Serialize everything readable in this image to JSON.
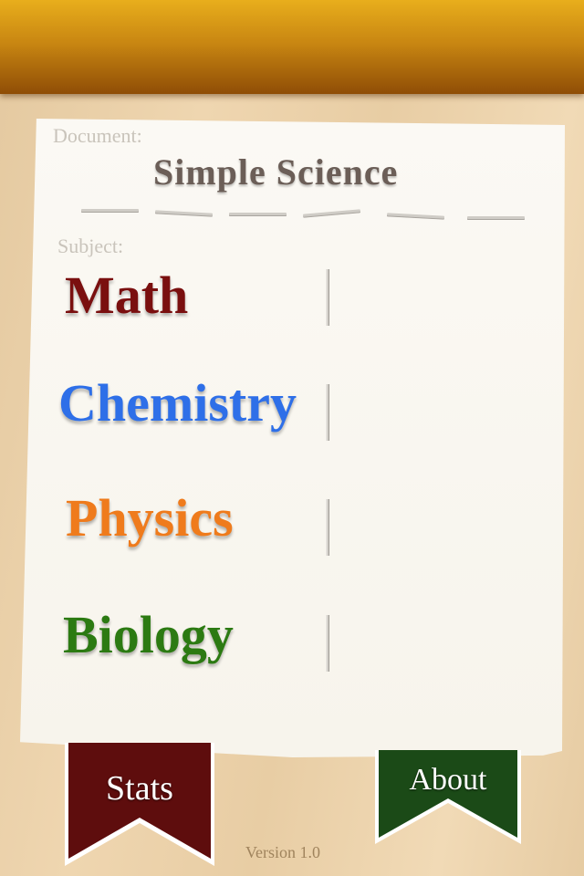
{
  "document": {
    "caption": "Document:",
    "title": "Simple Science"
  },
  "subjects": {
    "caption": "Subject:",
    "items": [
      {
        "label": "Math",
        "color": "#7a0f0f"
      },
      {
        "label": "Chemistry",
        "color": "#2e6fe8"
      },
      {
        "label": "Physics",
        "color": "#ef7b1c"
      },
      {
        "label": "Biology",
        "color": "#2c7a12"
      }
    ]
  },
  "ribbons": {
    "stats_label": "Stats",
    "stats_color": "#5e0d0d",
    "about_label": "About",
    "about_color": "#1b4a17"
  },
  "footer": {
    "version": "Version 1.0"
  },
  "theme": {
    "topbar": "#c98712",
    "paper": "#f9f6f0"
  }
}
